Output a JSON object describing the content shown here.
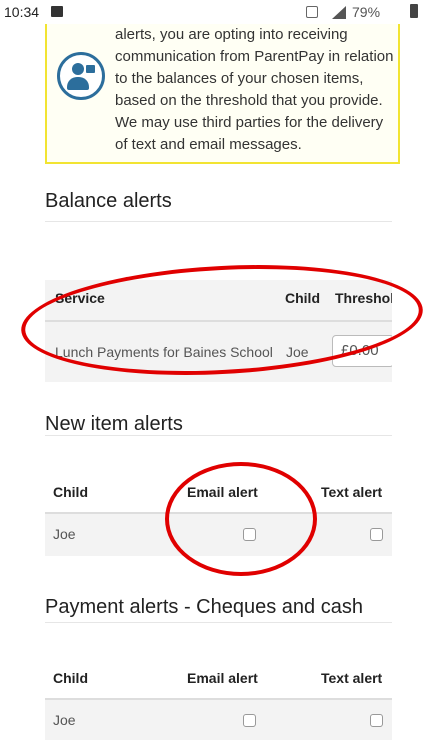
{
  "status_bar": {
    "time": "10:34",
    "battery": "79%"
  },
  "notice": {
    "text": "alerts, you are opting into receiving communication from ParentPay in relation to the balances of your chosen items, based on the threshold that you provide. We may use third parties for the delivery of text and email messages."
  },
  "balance_alerts": {
    "title": "Balance alerts",
    "headers": {
      "service": "Service",
      "child": "Child",
      "threshold": "Threshold"
    },
    "row": {
      "service": "Lunch Payments for Baines School",
      "child": "Joe",
      "threshold": "£0.00"
    }
  },
  "new_item_alerts": {
    "title": "New item alerts",
    "headers": {
      "child": "Child",
      "email": "Email alert",
      "text": "Text alert"
    },
    "row": {
      "child": "Joe"
    }
  },
  "payment_alerts": {
    "title": "Payment alerts - Cheques and cash",
    "headers": {
      "child": "Child",
      "email": "Email alert",
      "text": "Text alert"
    },
    "row": {
      "child": "Joe"
    }
  },
  "colors": {
    "annotation": "#e00000",
    "notice_border": "#f2e431",
    "icon": "#2c6e9c"
  }
}
